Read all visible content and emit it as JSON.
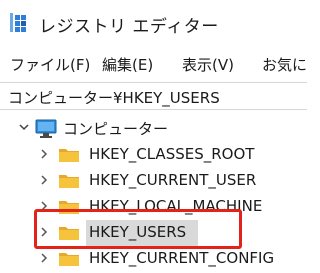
{
  "window": {
    "title": "レジストリ エディター"
  },
  "menu": [
    "ファイル(F)",
    "編集(E)",
    "表示(V)",
    "お気に"
  ],
  "address": {
    "path": "コンピューター¥HKEY_USERS"
  },
  "tree": {
    "root": {
      "label": "コンピューター",
      "expanded": true
    },
    "children": [
      {
        "label": "HKEY_CLASSES_ROOT"
      },
      {
        "label": "HKEY_CURRENT_USER"
      },
      {
        "label": "HKEY_LOCAL_MACHINE"
      },
      {
        "label": "HKEY_USERS",
        "selected": true
      },
      {
        "label": "HKEY_CURRENT_CONFIG"
      }
    ]
  },
  "colors": {
    "highlight": "#e2231a",
    "selection": "#d9d9d9",
    "folder": "#f6c33c"
  }
}
